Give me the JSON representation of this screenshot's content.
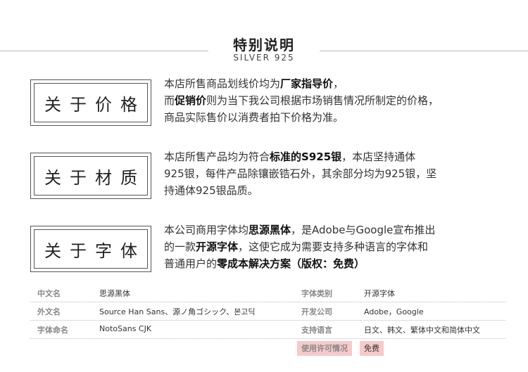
{
  "header": {
    "title": "特别说明",
    "subtitle": "SILVER 925"
  },
  "sections": [
    {
      "label": "关于价格",
      "lines": [
        {
          "a": "本店所售商品划线价均为",
          "b": "厂家指导价",
          "c": "，"
        },
        {
          "a": "而",
          "b": "促销价",
          "c": "则为当下我公司根据市场销售情况所制定的价格，"
        },
        {
          "a": "商品实际售价以消费者拍下价格为准。",
          "b": "",
          "c": ""
        }
      ]
    },
    {
      "label": "关于材质",
      "lines": [
        {
          "a": "本店所售产品均为符合",
          "b": "标准的S925银",
          "c": "，本店坚持通体"
        },
        {
          "a": "925银，每件产品除镶嵌锆石外，其余部分均为925银，坚",
          "b": "",
          "c": ""
        },
        {
          "a": "持通体925银品质。",
          "b": "",
          "c": ""
        }
      ]
    },
    {
      "label": "关于字体",
      "lines": [
        {
          "a": "本公司商用字体均",
          "b": "思源黑体",
          "c": "，是Adobe与Google宣布推出"
        },
        {
          "a": "的一款",
          "b": "开源字体",
          "c": "，这使它成为需要支持多种语言的字体和"
        },
        {
          "a": "普通用户的",
          "b": "零成本解决方案（版权：免费）",
          "c": ""
        }
      ]
    }
  ],
  "table": [
    {
      "k1": "中文名",
      "v1": "思源黑体",
      "k2": "字体类别",
      "v2": "开源字体"
    },
    {
      "k1": "外文名",
      "v1": "Source Han Sans、源ノ角ゴシック、본고딕",
      "k2": "开发公司",
      "v2": "Adobe，Google"
    },
    {
      "k1": "字体命名",
      "v1": "NotoSans CJK",
      "k2": "支持语言",
      "v2": "日文、韩文、繁体中文和简体中文"
    },
    {
      "k1": "",
      "v1": "",
      "k2": "使用许可情况",
      "v2": "免费"
    }
  ]
}
